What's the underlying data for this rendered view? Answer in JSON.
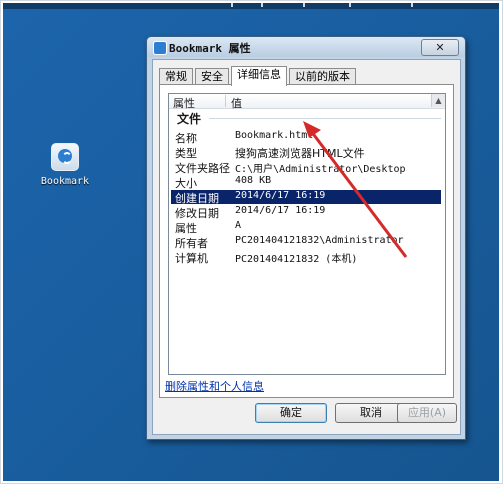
{
  "desktop": {
    "icon_label": "Bookmark",
    "background": "#195e9f"
  },
  "dialog": {
    "title": "Bookmark 属性",
    "close_glyph": "✕",
    "tabs": [
      "常规",
      "安全",
      "详细信息",
      "以前的版本"
    ],
    "active_tab": "详细信息",
    "list": {
      "col_property": "属性",
      "col_value": "值",
      "group_label": "文件",
      "rows": [
        {
          "key": "名称",
          "value": "Bookmark.html"
        },
        {
          "key": "类型",
          "value": "搜狗高速浏览器HTML文件"
        },
        {
          "key": "文件夹路径",
          "value": "C:\\用户\\Administrator\\Desktop"
        },
        {
          "key": "大小",
          "value": "408 KB"
        },
        {
          "key": "创建日期",
          "value": "2014/6/17 16:19",
          "selected": true
        },
        {
          "key": "修改日期",
          "value": "2014/6/17 16:19"
        },
        {
          "key": "属性",
          "value": "A"
        },
        {
          "key": "所有者",
          "value": "PC201404121832\\Administrator"
        },
        {
          "key": "计算机",
          "value": "PC201404121832 (本机)"
        }
      ]
    },
    "remove_link": "删除属性和个人信息",
    "buttons": {
      "ok": "确定",
      "cancel": "取消",
      "apply": "应用(A)"
    }
  },
  "annotation_color": "#d42a2a"
}
